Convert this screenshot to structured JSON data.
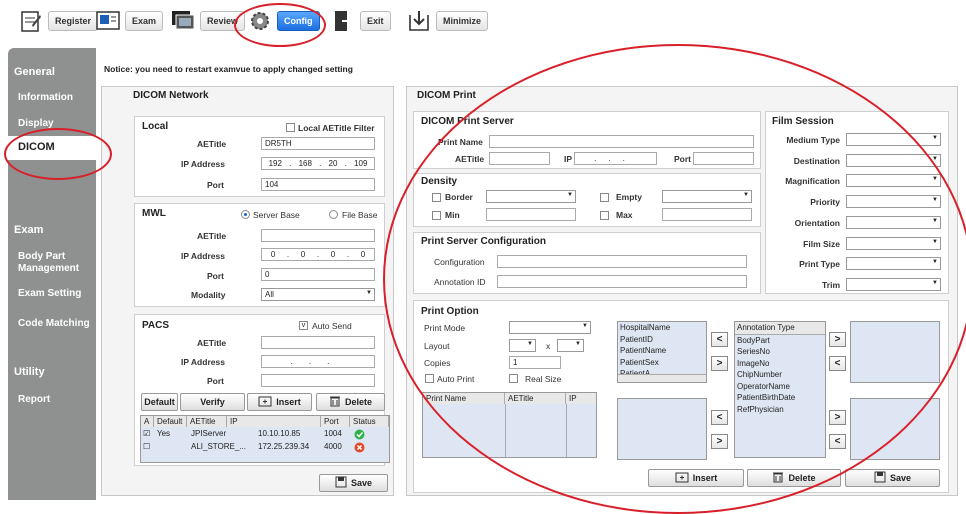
{
  "toolbar": {
    "register": "Register",
    "exam": "Exam",
    "review": "Review",
    "config": "Config",
    "exit": "Exit",
    "minimize": "Minimize"
  },
  "sidebar": {
    "general": "General",
    "information": "Information",
    "display": "Display",
    "dicom": "DICOM",
    "exam": "Exam",
    "body_part": "Body Part Management",
    "exam_setting": "Exam Setting",
    "code_matching": "Code Matching",
    "utility": "Utility",
    "report": "Report"
  },
  "notice": "Notice: you need to restart examvue to apply changed setting",
  "dicom_network": {
    "title": "DICOM Network",
    "local": {
      "title": "Local",
      "filter_label": "Local AETitle Filter",
      "aetitle_label": "AETitle",
      "aetitle_value": "DR5TH",
      "ip_label": "IP Address",
      "ip": [
        "192",
        "168",
        "20",
        "109"
      ],
      "port_label": "Port",
      "port_value": "104"
    },
    "mwl": {
      "title": "MWL",
      "server_base": "Server Base",
      "file_base": "File Base",
      "aetitle_label": "AETitle",
      "ip_label": "IP Address",
      "ip": [
        "0",
        "0",
        "0",
        "0"
      ],
      "port_label": "Port",
      "port_value": "0",
      "modality_label": "Modality",
      "modality_value": "All"
    },
    "pacs": {
      "title": "PACS",
      "auto_send": "Auto Send",
      "aetitle_label": "AETitle",
      "ip_label": "IP Address",
      "port_label": "Port",
      "default_btn": "Default",
      "verify_btn": "Verify",
      "insert_btn": "Insert",
      "delete_btn": "Delete",
      "columns": [
        "A",
        "Default",
        "AETitle",
        "IP",
        "Port",
        "Status"
      ],
      "rows": [
        {
          "check": "☑",
          "default": "Yes",
          "aetitle": "JPIServer",
          "ip": "10.10.10.85",
          "port": "1004",
          "status": "ok"
        },
        {
          "check": "☐",
          "default": "",
          "aetitle": "ALI_STORE_...",
          "ip": "172.25.239.34",
          "port": "4000",
          "status": "error"
        }
      ],
      "save_btn": "Save"
    }
  },
  "dicom_print": {
    "title": "DICOM Print",
    "server": {
      "title": "DICOM Print Server",
      "print_name": "Print Name",
      "aetitle": "AETitle",
      "ip": "IP",
      "port": "Port"
    },
    "density": {
      "title": "Density",
      "border": "Border",
      "empty": "Empty",
      "min": "Min",
      "max": "Max"
    },
    "print_server_config": {
      "title": "Print Server Configuration",
      "configuration": "Configuration",
      "annotation_id": "Annotation ID"
    },
    "film_session": {
      "title": "Film Session",
      "fields": [
        "Medium Type",
        "Destination",
        "Magnification",
        "Priority",
        "Orientation",
        "Film Size",
        "Print Type",
        "Trim"
      ]
    },
    "print_option": {
      "title": "Print Option",
      "print_mode": "Print Mode",
      "layout": "Layout",
      "x": "x",
      "copies": "Copies",
      "copies_value": "1",
      "auto_print": "Auto Print",
      "real_size": "Real Size",
      "table_cols": [
        "Print Name",
        "AETitle",
        "IP"
      ],
      "left_list": [
        "HospitalName",
        "PatientID",
        "PatientName",
        "PatientSex",
        "PatientA..."
      ],
      "annotation_list": [
        "Annotation Type",
        "BodyPart",
        "SeriesNo",
        "ImageNo",
        "ChipNumber",
        "OperatorName",
        "PatientBirthDate",
        "RefPhysician"
      ],
      "insert_btn": "Insert",
      "delete_btn": "Delete",
      "save_btn": "Save"
    }
  }
}
